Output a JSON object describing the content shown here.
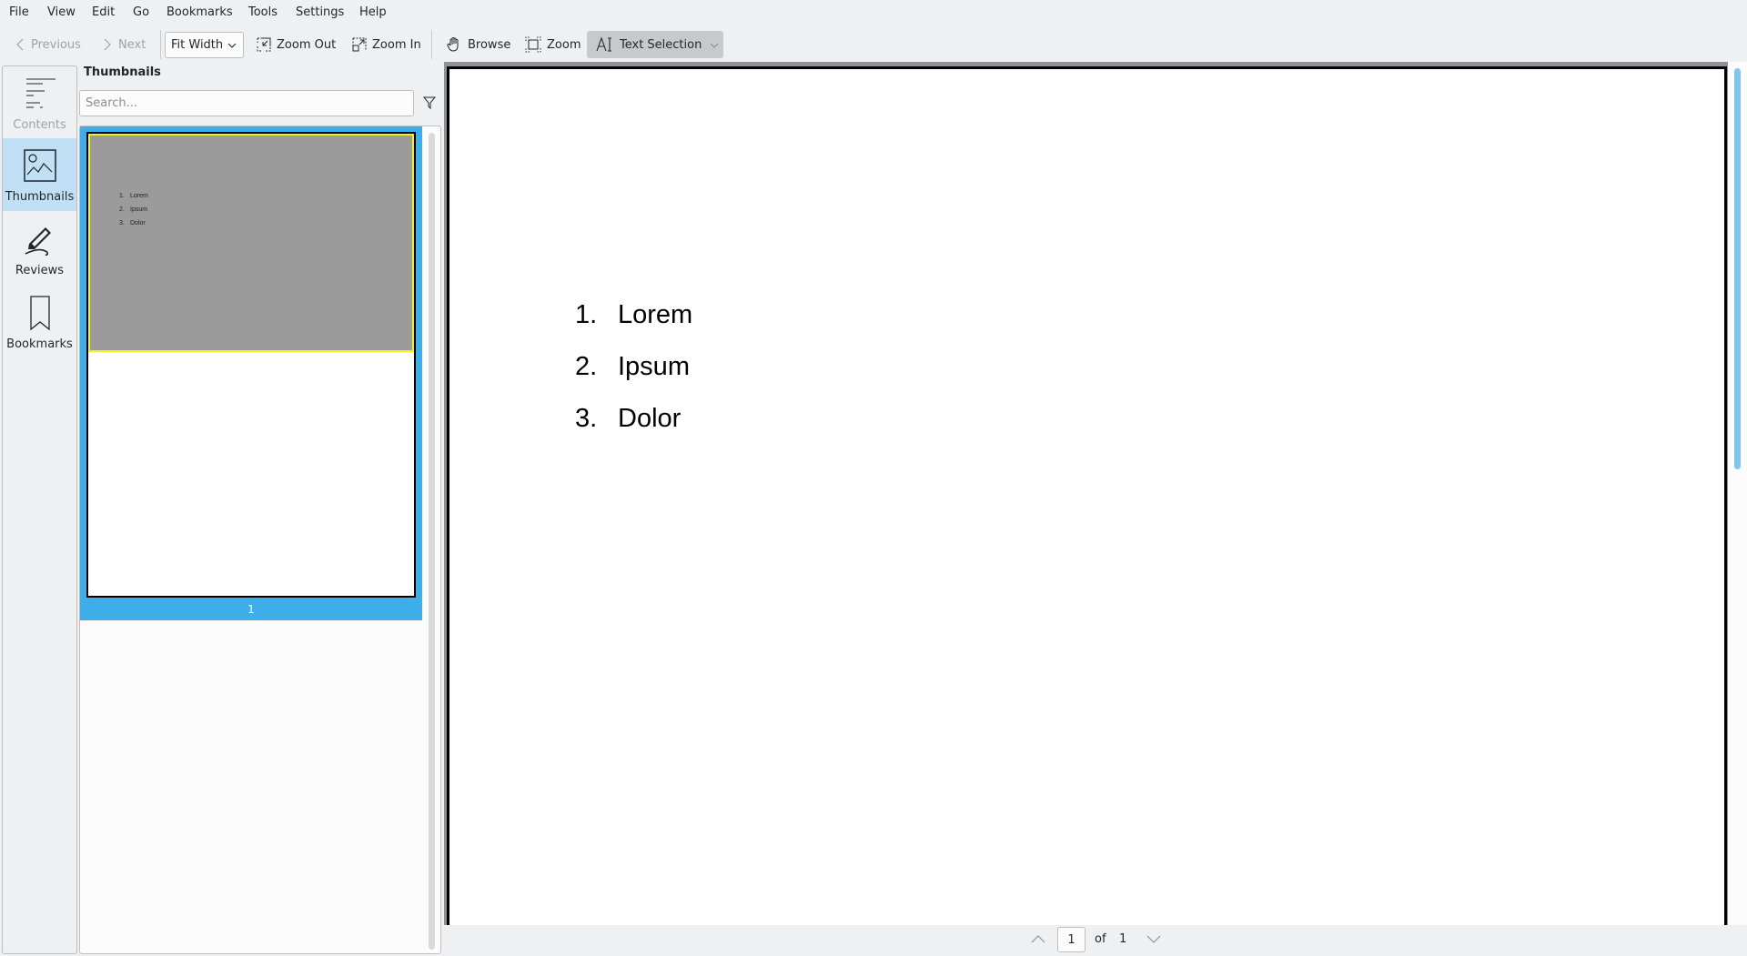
{
  "menubar": {
    "items": [
      "File",
      "View",
      "Edit",
      "Go",
      "Bookmarks",
      "Tools",
      "Settings",
      "Help"
    ]
  },
  "toolbar": {
    "previous_label": "Previous",
    "next_label": "Next",
    "zoom_mode_value": "Fit Width",
    "zoom_out_label": "Zoom Out",
    "zoom_in_label": "Zoom In",
    "browse_label": "Browse",
    "zoom_tool_label": "Zoom",
    "text_selection_label": "Text Selection"
  },
  "sidebar": {
    "items": [
      {
        "label": "Contents",
        "icon": "table-of-contents-icon",
        "enabled": false
      },
      {
        "label": "Thumbnails",
        "icon": "image-icon",
        "selected": true
      },
      {
        "label": "Reviews",
        "icon": "pen-icon"
      },
      {
        "label": "Bookmarks",
        "icon": "bookmark-icon"
      }
    ]
  },
  "thumbnails_panel": {
    "title": "Thumbnails",
    "search_placeholder": "Search...",
    "search_value": "",
    "pages": [
      {
        "number": "1",
        "selected": true,
        "list": [
          {
            "num": "1.",
            "text": "Lorem"
          },
          {
            "num": "2.",
            "text": "Ipsum"
          },
          {
            "num": "3.",
            "text": "Dolor"
          }
        ]
      }
    ]
  },
  "document": {
    "list": [
      {
        "num": "1.",
        "text": "Lorem"
      },
      {
        "num": "2.",
        "text": "Ipsum"
      },
      {
        "num": "3.",
        "text": "Dolor"
      }
    ]
  },
  "pagebar": {
    "current_page": "1",
    "of_label": "of",
    "total_pages": "1"
  },
  "colors": {
    "accent": "#3daee9",
    "sidebar_selected": "#c2e0f5",
    "scroll_thumb": "#7dc7ed",
    "thumbnail_highlight": "#9b9b9b"
  }
}
